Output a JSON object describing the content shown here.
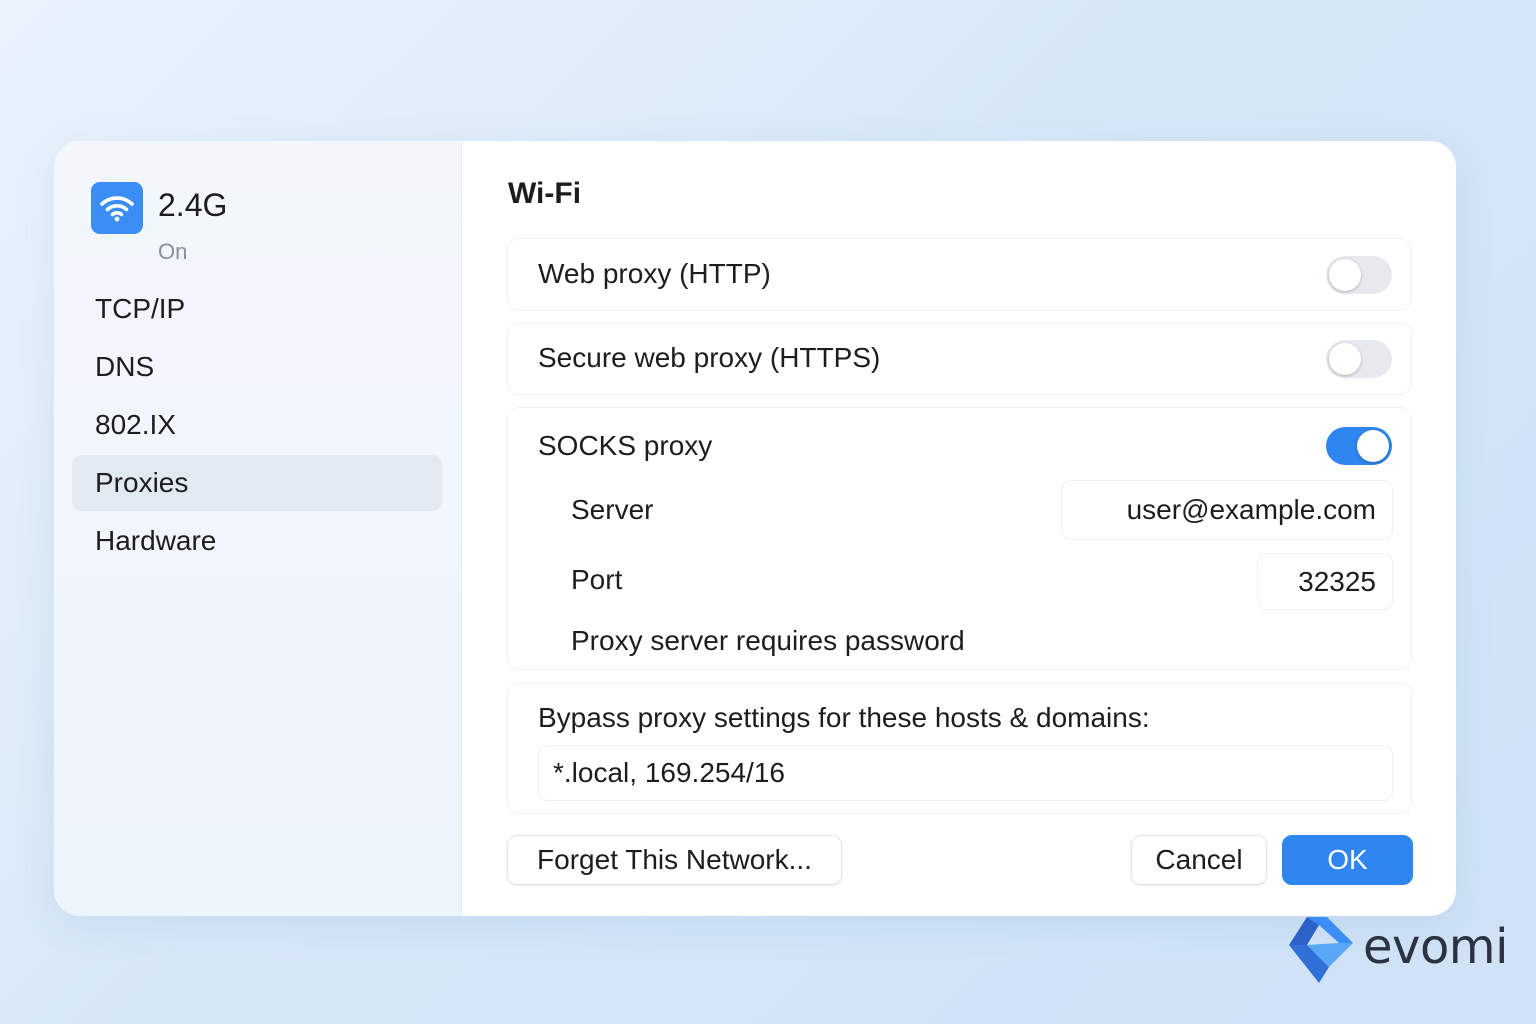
{
  "network": {
    "name": "2.4G",
    "status": "On",
    "icon": "wifi-icon"
  },
  "sidebar": {
    "items": [
      {
        "label": "TCP/IP",
        "active": false
      },
      {
        "label": "DNS",
        "active": false
      },
      {
        "label": "802.IX",
        "active": false
      },
      {
        "label": "Proxies",
        "active": true
      },
      {
        "label": "Hardware",
        "active": false
      }
    ]
  },
  "main": {
    "title": "Wi-Fi",
    "web_proxy": {
      "label": "Web proxy (HTTP)",
      "enabled": false
    },
    "secure_proxy": {
      "label": "Secure web proxy (HTTPS)",
      "enabled": false
    },
    "socks_proxy": {
      "label": "SOCKS proxy",
      "enabled": true,
      "server_label": "Server",
      "server_value": "user@example.com",
      "port_label": "Port",
      "port_value": "32325",
      "password_label": "Proxy server requires password"
    },
    "bypass": {
      "label": "Bypass proxy settings for these hosts & domains:",
      "value": "*.local, 169.254/16"
    }
  },
  "buttons": {
    "forget": "Forget This Network...",
    "cancel": "Cancel",
    "ok": "OK"
  },
  "brand": {
    "name": "evomi"
  },
  "colors": {
    "accent": "#2f86f0",
    "wifi_icon_bg": "#3a8ef5",
    "sidebar_active": "#e1e9f2"
  }
}
